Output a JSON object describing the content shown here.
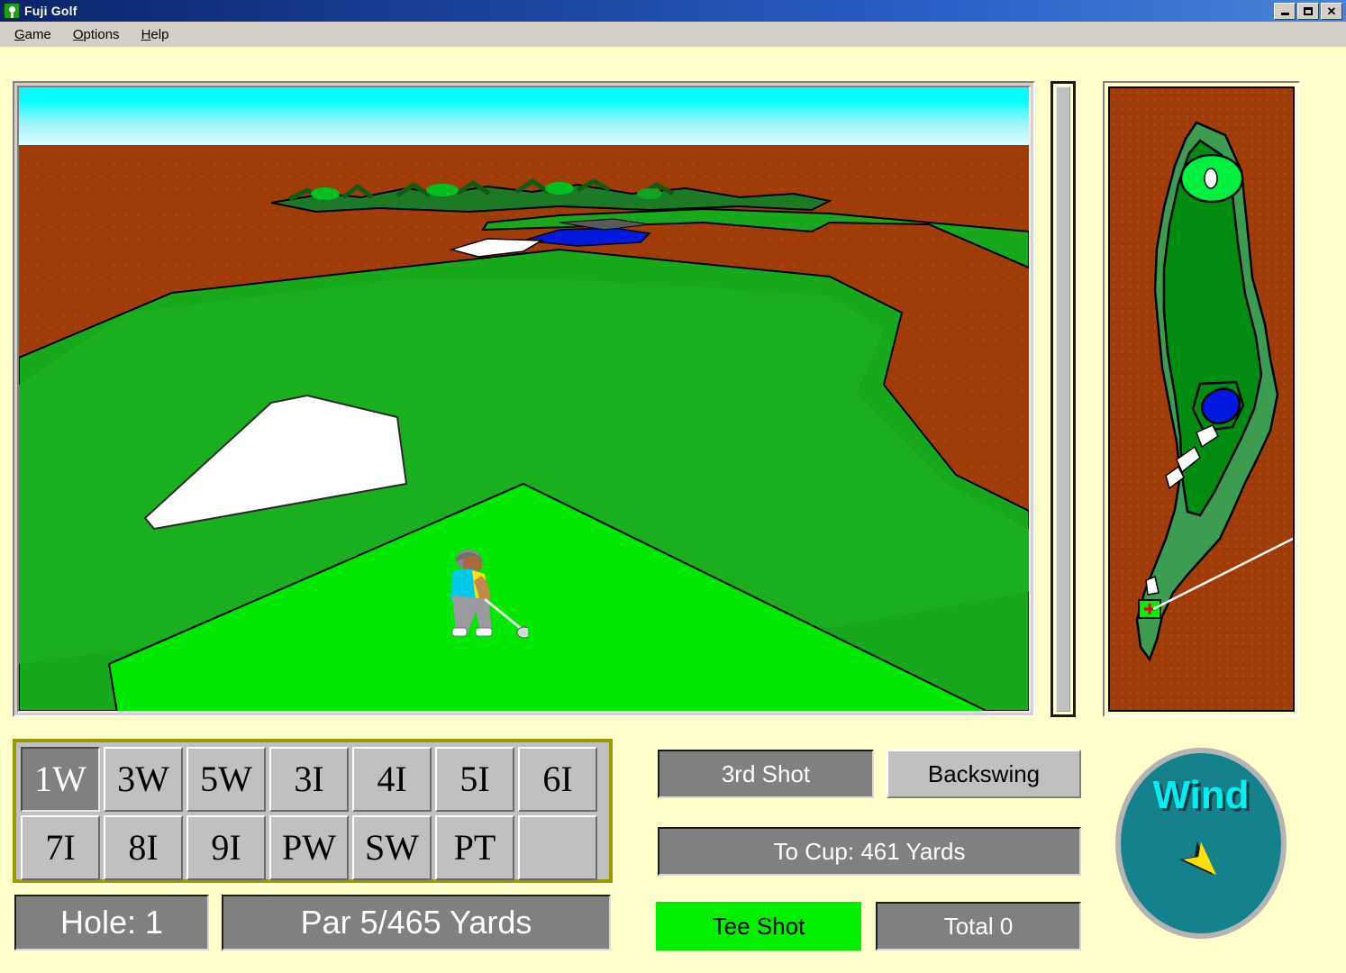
{
  "window": {
    "title": "Fuji Golf",
    "icon": "golf-ball-icon",
    "controls": {
      "minimize": "_",
      "maximize": "❐",
      "close": "✕"
    }
  },
  "menu": {
    "items": [
      {
        "label": "Game",
        "accel": "G"
      },
      {
        "label": "Options",
        "accel": "O"
      },
      {
        "label": "Help",
        "accel": "H"
      }
    ]
  },
  "clubs": {
    "selected": "1W",
    "row1": [
      "1W",
      "3W",
      "5W",
      "3I",
      "4I",
      "5I",
      "6I"
    ],
    "row2": [
      "7I",
      "8I",
      "9I",
      "PW",
      "SW",
      "PT",
      ""
    ]
  },
  "status": {
    "hole": "Hole: 1",
    "par": "Par 5/465 Yards",
    "shot": "3rd Shot",
    "backswing": "Backswing",
    "to_cup": "To Cup: 461 Yards",
    "tee_shot": "Tee Shot",
    "total": "Total 0"
  },
  "wind": {
    "label": "Wind",
    "direction_deg": 135
  },
  "colors": {
    "app_background": "#ffffcc",
    "titlebar": "#0a246a",
    "menubar": "#d4d0c8",
    "plate_bg": "#808080",
    "plate_text": "#ffffff",
    "club_panel_border": "#9a9a00",
    "club_face": "#c0c0c0",
    "club_selected": "#808080",
    "tee_shot_bg": "#00f000",
    "wind_face": "#14818c",
    "wind_text": "#00f0f0",
    "wind_arrow": "#ffe000",
    "sky_top": "#00ffff",
    "sky_bottom": "#ddfdff",
    "dirt": "#a03c08",
    "rough": "#3c9c50",
    "fairway": "#18a81c",
    "tee_grass": "#00e800",
    "green": "#00f040",
    "sand": "#ffffff",
    "water": "#0018e0"
  },
  "minimap": {
    "name": "hole-overview-map",
    "features": [
      "rough",
      "fairway",
      "green",
      "hole-cup",
      "water-hazard",
      "bunkers",
      "tee-marker",
      "aim-line"
    ]
  },
  "meter": {
    "name": "swing-power-meter",
    "value": 0
  }
}
